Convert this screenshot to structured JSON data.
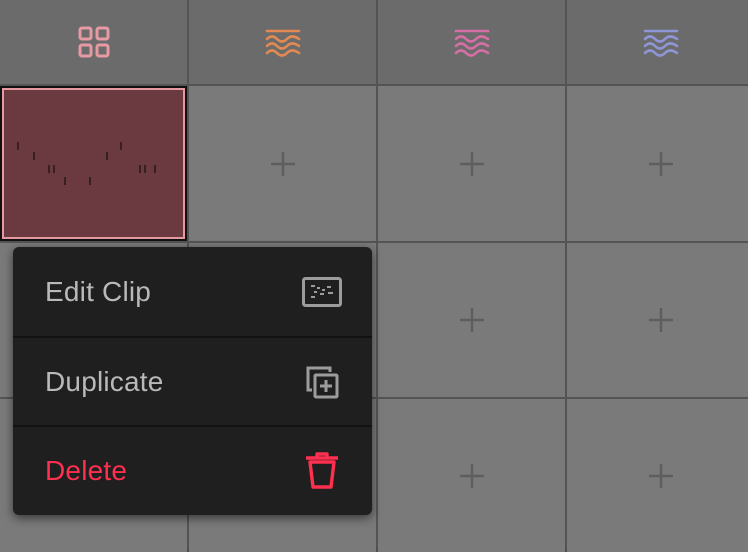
{
  "tracks": [
    {
      "icon": "grid-icon",
      "color": "#e69aa3"
    },
    {
      "icon": "wave-icon",
      "color": "#e28a52"
    },
    {
      "icon": "wave-icon",
      "color": "#d56fa6"
    },
    {
      "icon": "wave-icon",
      "color": "#8e96d6"
    }
  ],
  "clip": {
    "fill": "#6b3a40",
    "border": "#e59aa2"
  },
  "context_menu": {
    "items": [
      {
        "label": "Edit Clip",
        "icon": "piano-roll-icon"
      },
      {
        "label": "Duplicate",
        "icon": "duplicate-icon"
      },
      {
        "label": "Delete",
        "icon": "trash-icon",
        "color": "#ff2f4f"
      }
    ]
  }
}
